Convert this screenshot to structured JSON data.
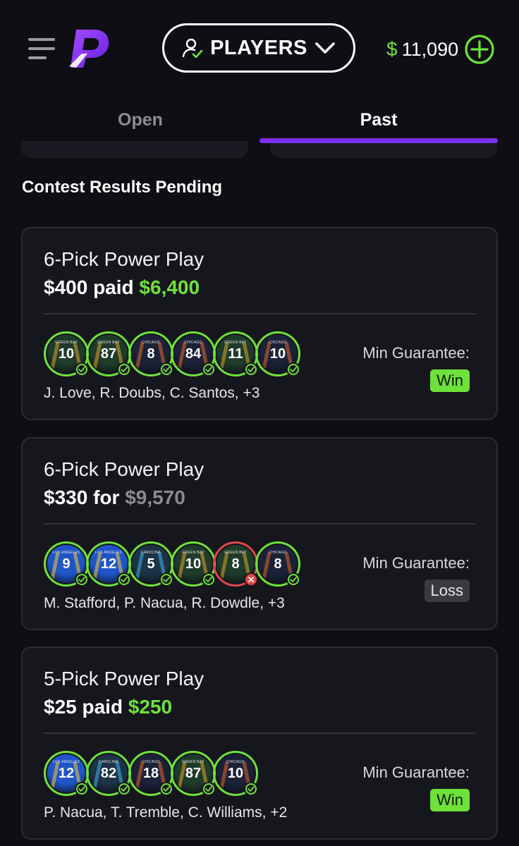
{
  "header": {
    "players_label": "PLAYERS",
    "balance_currency": "$",
    "balance_amount": "11,090",
    "icons": {
      "menu": "hamburger-menu-icon",
      "logo": "app-logo-icon",
      "players": "user-check-icon",
      "dropdown": "chevron-down-icon",
      "add": "plus-circle-icon"
    }
  },
  "tabs": [
    {
      "label": "Open",
      "active": false
    },
    {
      "label": "Past",
      "active": true
    }
  ],
  "section_title": "Contest Results Pending",
  "colors": {
    "accent_green": "#6ee23a",
    "accent_purple": "#7b2ff2",
    "loss_red": "#e04848",
    "background": "#0e0e14",
    "card": "#16161d"
  },
  "cards": [
    {
      "type": "6-Pick Power Play",
      "stake": "$400",
      "connector": "paid",
      "payout": "$6,400",
      "payout_style": "green",
      "players": [
        {
          "team": "GREEN BAY",
          "number": "10",
          "jersey": "green",
          "result": "check"
        },
        {
          "team": "GREEN BAY",
          "number": "87",
          "jersey": "green",
          "result": "check"
        },
        {
          "team": "CHICAGO",
          "number": "8",
          "jersey": "navy",
          "result": "check"
        },
        {
          "team": "CHICAGO",
          "number": "84",
          "jersey": "navy",
          "result": "check"
        },
        {
          "team": "GREEN BAY",
          "number": "11",
          "jersey": "green",
          "result": "check"
        },
        {
          "team": "CHICAGO",
          "number": "10",
          "jersey": "navy",
          "result": "check"
        }
      ],
      "names": "J. Love, R. Doubs, C. Santos, +3",
      "guarantee_label": "Min Guarantee:",
      "result": "Win"
    },
    {
      "type": "6-Pick Power Play",
      "stake": "$330",
      "connector": "for",
      "payout": "$9,570",
      "payout_style": "grey",
      "players": [
        {
          "team": "LOS ANGELES",
          "number": "9",
          "jersey": "blue",
          "result": "check"
        },
        {
          "team": "LOS ANGELES",
          "number": "12",
          "jersey": "blue",
          "result": "check"
        },
        {
          "team": "CAROLINA",
          "number": "5",
          "jersey": "teal",
          "result": "check"
        },
        {
          "team": "GREEN BAY",
          "number": "10",
          "jersey": "green",
          "result": "check"
        },
        {
          "team": "GREEN BAY",
          "number": "8",
          "jersey": "green",
          "result": "x"
        },
        {
          "team": "CHICAGO",
          "number": "8",
          "jersey": "navy",
          "result": "check"
        }
      ],
      "names": "M. Stafford, P. Nacua, R. Dowdle, +3",
      "guarantee_label": "Min Guarantee:",
      "result": "Loss"
    },
    {
      "type": "5-Pick Power Play",
      "stake": "$25",
      "connector": "paid",
      "payout": "$250",
      "payout_style": "green",
      "players": [
        {
          "team": "LOS ANGELES",
          "number": "12",
          "jersey": "blue",
          "result": "check"
        },
        {
          "team": "CAROLINA",
          "number": "82",
          "jersey": "teal",
          "result": "check"
        },
        {
          "team": "CHICAGO",
          "number": "18",
          "jersey": "navy",
          "result": "check"
        },
        {
          "team": "GREEN BAY",
          "number": "87",
          "jersey": "green",
          "result": "check"
        },
        {
          "team": "CHICAGO",
          "number": "10",
          "jersey": "navy",
          "result": "check"
        }
      ],
      "names": "P. Nacua, T. Tremble, C. Williams, +2",
      "guarantee_label": "Min Guarantee:",
      "result": "Win"
    }
  ]
}
